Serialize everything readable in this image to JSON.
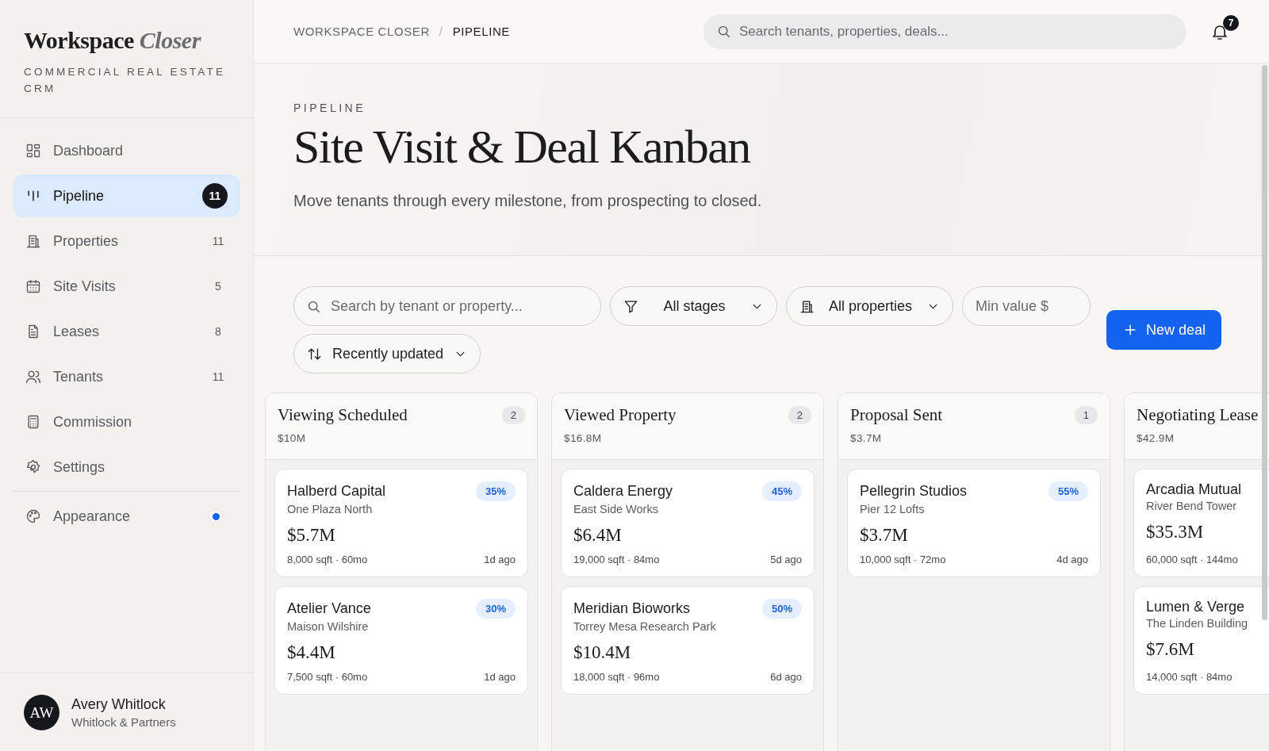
{
  "sidebar": {
    "brand": {
      "name": "Workspace",
      "accent": "Closer",
      "tagline": "COMMERCIAL REAL ESTATE CRM"
    },
    "nav": [
      {
        "label": "Dashboard",
        "selected": false
      },
      {
        "label": "Pipeline",
        "selected": true,
        "count": "11"
      },
      {
        "label": "Properties",
        "selected": false,
        "count": "11"
      },
      {
        "label": "Site Visits",
        "selected": false,
        "count": "5"
      },
      {
        "label": "Leases",
        "selected": false,
        "count": "8"
      },
      {
        "label": "Tenants",
        "selected": false,
        "count": "11"
      },
      {
        "label": "Commission",
        "selected": false
      },
      {
        "label": "Settings",
        "selected": false
      }
    ],
    "appearance": {
      "label": "Appearance",
      "on": true
    },
    "user": {
      "initials": "AW",
      "name": "Avery Whitlock",
      "company": "Whitlock & Partners"
    }
  },
  "header": {
    "breadcrumbs": [
      {
        "label": "WORKSPACE CLOSER",
        "current": false
      },
      {
        "label": "PIPELINE",
        "current": true
      }
    ],
    "separator": "/",
    "search": {
      "placeholder": "Search tenants, properties, deals..."
    },
    "notifications": {
      "count": "7"
    }
  },
  "hero": {
    "eyebrow": "PIPELINE",
    "title": "Site Visit & Deal Kanban",
    "subtitle": "Move tenants through every milestone, from prospecting to closed."
  },
  "filters": [
    {
      "kind": "search",
      "placeholder": "Search by tenant or property..."
    },
    {
      "kind": "select",
      "value": "All stages"
    },
    {
      "kind": "select",
      "value": "All properties"
    },
    {
      "kind": "input",
      "placeholder": "Min value $"
    },
    {
      "kind": "select",
      "value": "Recently updated"
    }
  ],
  "new_deal": {
    "label": "New deal"
  },
  "columns": [
    {
      "title": "Viewing Scheduled",
      "count": "2",
      "total": "$10M",
      "cards": [
        {
          "tenant": "Halberd Capital",
          "property": "One Plaza North",
          "percent": "35%",
          "value": "$5.7M",
          "meta": "8,000 sqft · 60mo",
          "age": "1d ago"
        },
        {
          "tenant": "Atelier Vance",
          "property": "Maison Wilshire",
          "percent": "30%",
          "value": "$4.4M",
          "meta": "7,500 sqft · 60mo",
          "age": "1d ago"
        }
      ]
    },
    {
      "title": "Viewed Property",
      "count": "2",
      "total": "$16.8M",
      "cards": [
        {
          "tenant": "Caldera Energy",
          "property": "East Side Works",
          "percent": "45%",
          "value": "$6.4M",
          "meta": "19,000 sqft · 84mo",
          "age": "5d ago"
        },
        {
          "tenant": "Meridian Bioworks",
          "property": "Torrey Mesa Research Park",
          "percent": "50%",
          "value": "$10.4M",
          "meta": "18,000 sqft · 96mo",
          "age": "6d ago"
        }
      ]
    },
    {
      "title": "Proposal Sent",
      "count": "1",
      "total": "$3.7M",
      "cards": [
        {
          "tenant": "Pellegrin Studios",
          "property": "Pier 12 Lofts",
          "percent": "55%",
          "value": "$3.7M",
          "meta": "10,000 sqft · 72mo",
          "age": "4d ago"
        }
      ]
    },
    {
      "title": "Negotiating Lease",
      "total": "$42.9M",
      "cards": [
        {
          "tenant": "Arcadia Mutual",
          "property": "River Bend Tower",
          "value": "$35.3M",
          "meta": "60,000 sqft · 144mo"
        },
        {
          "tenant": "Lumen & Verge",
          "property": "The Linden Building",
          "value": "$7.6M",
          "meta": "14,000 sqft · 84mo"
        }
      ]
    }
  ]
}
